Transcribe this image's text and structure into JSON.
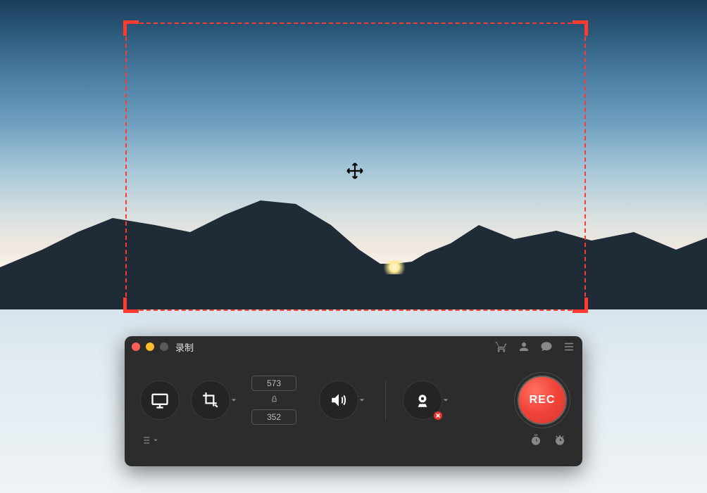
{
  "window": {
    "title": "录制"
  },
  "selection": {
    "width": "573",
    "height": "352"
  },
  "rec": {
    "label": "REC"
  },
  "colors": {
    "accent": "#ff3b30",
    "rec": "#f04338"
  }
}
